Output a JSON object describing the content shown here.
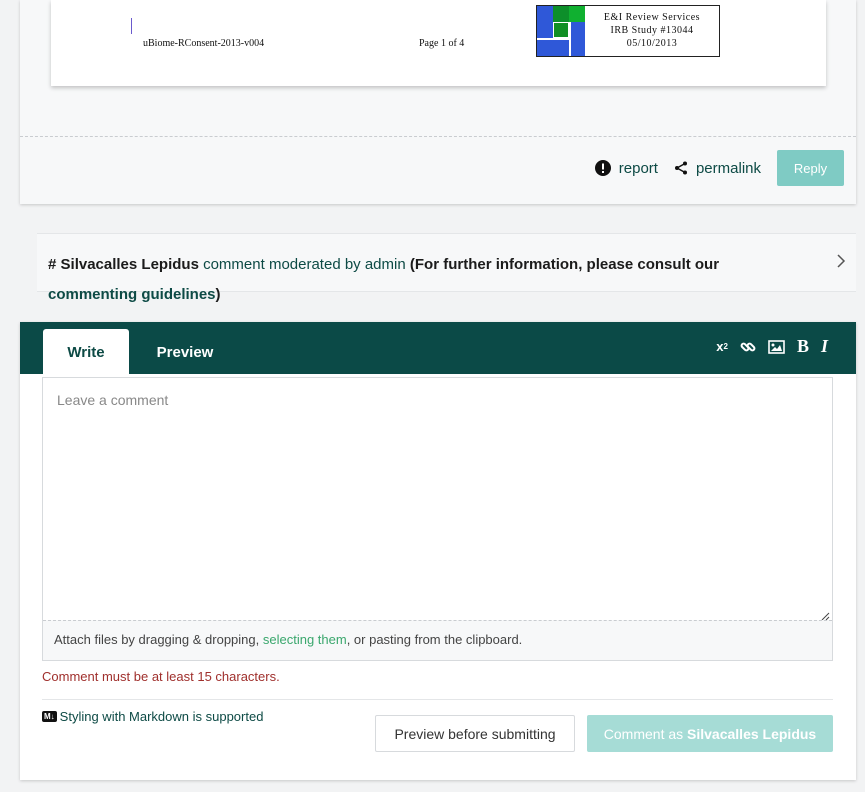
{
  "document": {
    "footer_left": "uBiome-RConsent-2013-v004",
    "footer_page": "Page 1 of 4",
    "irb_line1": "E&I Review Services",
    "irb_line2": "IRB Study #13044",
    "irb_line3": "05/10/2013"
  },
  "comment_actions": {
    "report_label": "report",
    "permalink_label": "permalink",
    "reply_label": "Reply"
  },
  "moderated": {
    "hash": "#",
    "user": "Silvacalles Lepidus",
    "text": "comment moderated by admin",
    "paren_open": "(For further information, please consult our",
    "link": "commenting guidelines",
    "paren_close": ")"
  },
  "editor": {
    "tab_write": "Write",
    "tab_preview": "Preview",
    "placeholder": "Leave a comment",
    "attach_prefix": "Attach files by dragging & dropping,",
    "attach_link": "selecting them",
    "attach_suffix": ", or pasting from the clipboard.",
    "error": "Comment must be at least 15 characters.",
    "markdown_badge": "M↓",
    "markdown_note": "Styling with Markdown is supported",
    "preview_button": "Preview before submitting",
    "submit_prefix": "Comment as",
    "submit_user": "Silvacalles Lepidus",
    "toolbar": [
      "superscript-icon",
      "link-icon",
      "image-icon",
      "bold-icon",
      "italic-icon"
    ]
  },
  "colors": {
    "brand_dark": "#0b4a47",
    "reply_button": "#7fcbc4",
    "submit_disabled": "#a6dcd6",
    "error": "#a0302d",
    "link_green": "#3aa76d"
  }
}
